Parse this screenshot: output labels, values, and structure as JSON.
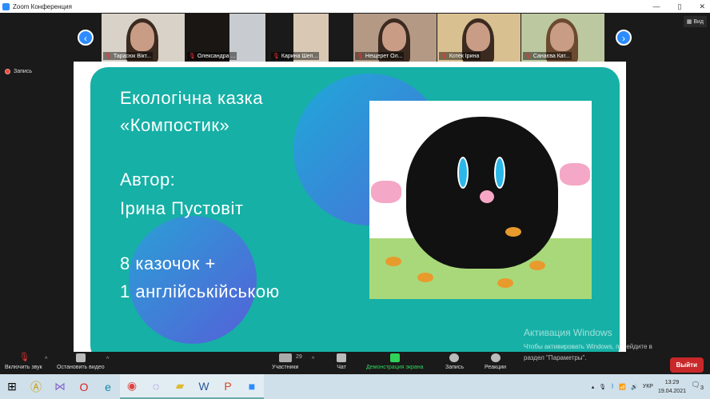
{
  "window": {
    "title": "Zoom Конференция",
    "min": "—",
    "max": "▯",
    "close": "✕"
  },
  "view_label": "Вид",
  "recording_label": "Запись",
  "participants": [
    {
      "name": "Тарасюк Вікт..."
    },
    {
      "name": "Олександра ..."
    },
    {
      "name": "Карина Шеп..."
    },
    {
      "name": "Нещерет Ол..."
    },
    {
      "name": "Котек Ірина"
    },
    {
      "name": "Санаєва Кат..."
    }
  ],
  "slide": {
    "title_line1": "Екологічна казка",
    "title_line2": "«Компостик»",
    "author_label": "Автор:",
    "author_name": "Ірина Пустовіт",
    "count_line1": "8 казочок +",
    "count_line2": "1 англійськійською",
    "accent": "#16b0a6"
  },
  "toolbar": {
    "unmute": "Включить звук",
    "video": "Остановить видео",
    "participants": "Участники",
    "participants_count": "29",
    "chat": "Чат",
    "share": "Демонстрация экрана",
    "record": "Запись",
    "reactions": "Реакции",
    "leave": "Выйти"
  },
  "watermark": {
    "line1": "Активация Windows",
    "line2": "Чтобы активировать Windows, перейдите в",
    "line3": "раздел \"Параметры\"."
  },
  "taskbar": {
    "lang": "УКР",
    "time": "13:29",
    "date": "19.04.2021",
    "notif": "3"
  }
}
